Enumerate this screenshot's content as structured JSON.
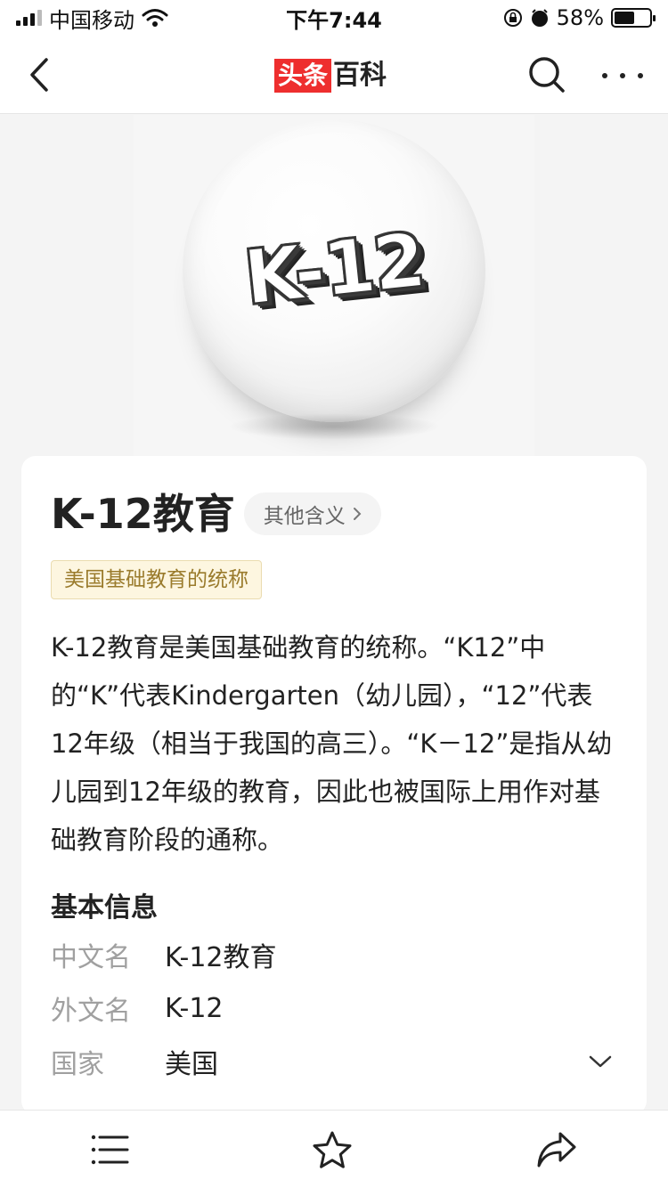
{
  "status_bar": {
    "carrier": "中国移动",
    "time": "下午7:44",
    "battery": "58%",
    "battery_level": 0.58
  },
  "header": {
    "logo_red": "头条",
    "logo_dark": "百科"
  },
  "entry": {
    "title": "K-12教育",
    "other_meaning": "其他含义",
    "tag": "美国基础教育的统称",
    "summary": "K-12教育是美国基础教育的统称。“K12”中的“K”代表Kindergarten（幼儿园），“12”代表12年级（相当于我国的高三）。“K－12”是指从幼儿园到12年级的教育，因此也被国际上用作对基础教育阶段的通称。"
  },
  "info": {
    "section_title": "基本信息",
    "rows": [
      {
        "label": "中文名",
        "value": "K-12教育"
      },
      {
        "label": "外文名",
        "value": "K-12"
      },
      {
        "label": "国家",
        "value": "美国"
      }
    ]
  },
  "hero": {
    "text": "K-12"
  },
  "icons": {
    "back": "chevron-left-icon",
    "search": "search-icon",
    "more": "more-icon",
    "expand": "chevron-down-icon",
    "menu": "menu-icon",
    "favorite": "star-icon",
    "share": "share-icon"
  }
}
